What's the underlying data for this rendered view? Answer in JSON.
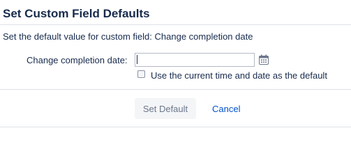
{
  "dialog": {
    "title": "Set Custom Field Defaults",
    "description": "Set the default value for custom field: Change completion date"
  },
  "form": {
    "field_label": "Change completion date:",
    "date_value": "",
    "calendar_icon": "calendar-icon",
    "checkbox_checked": false,
    "checkbox_label": "Use the current time and date as the default"
  },
  "actions": {
    "set_default_label": "Set Default",
    "set_default_disabled": true,
    "cancel_label": "Cancel"
  },
  "colors": {
    "text": "#172b4d",
    "link": "#0052cc",
    "divider": "#dfe1e6",
    "button_bg": "#f4f5f7",
    "button_text_disabled": "#6b778c"
  }
}
